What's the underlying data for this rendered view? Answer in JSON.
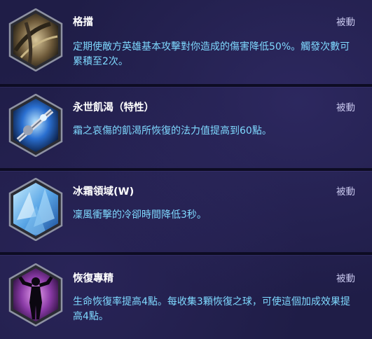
{
  "talents": [
    {
      "name": "格擋",
      "type": "被動",
      "description": "定期使敵方英雄基本攻擊對你造成的傷害降低50%。觸發次數可累積至2次。",
      "icon": "block-shield-icon"
    },
    {
      "name": "永世飢渴（特性）",
      "type": "被動",
      "description": "霜之哀傷的飢渴所恢復的法力值提高到60點。",
      "icon": "frostmourne-sword-icon"
    },
    {
      "name": "冰霜領域(W)",
      "type": "被動",
      "description": "凜風衝擊的冷卻時間降低3秒。",
      "icon": "ice-crystal-icon"
    },
    {
      "name": "恢復專精",
      "type": "被動",
      "description": "生命恢復率提高4點。每收集3顆恢復之球，可使這個加成效果提高4點。",
      "icon": "regeneration-silhouette-icon"
    }
  ],
  "colors": {
    "background": "#1f1d47",
    "title": "#ffffff",
    "description": "#7fd9ff",
    "type_label": "#c9c8ee"
  }
}
